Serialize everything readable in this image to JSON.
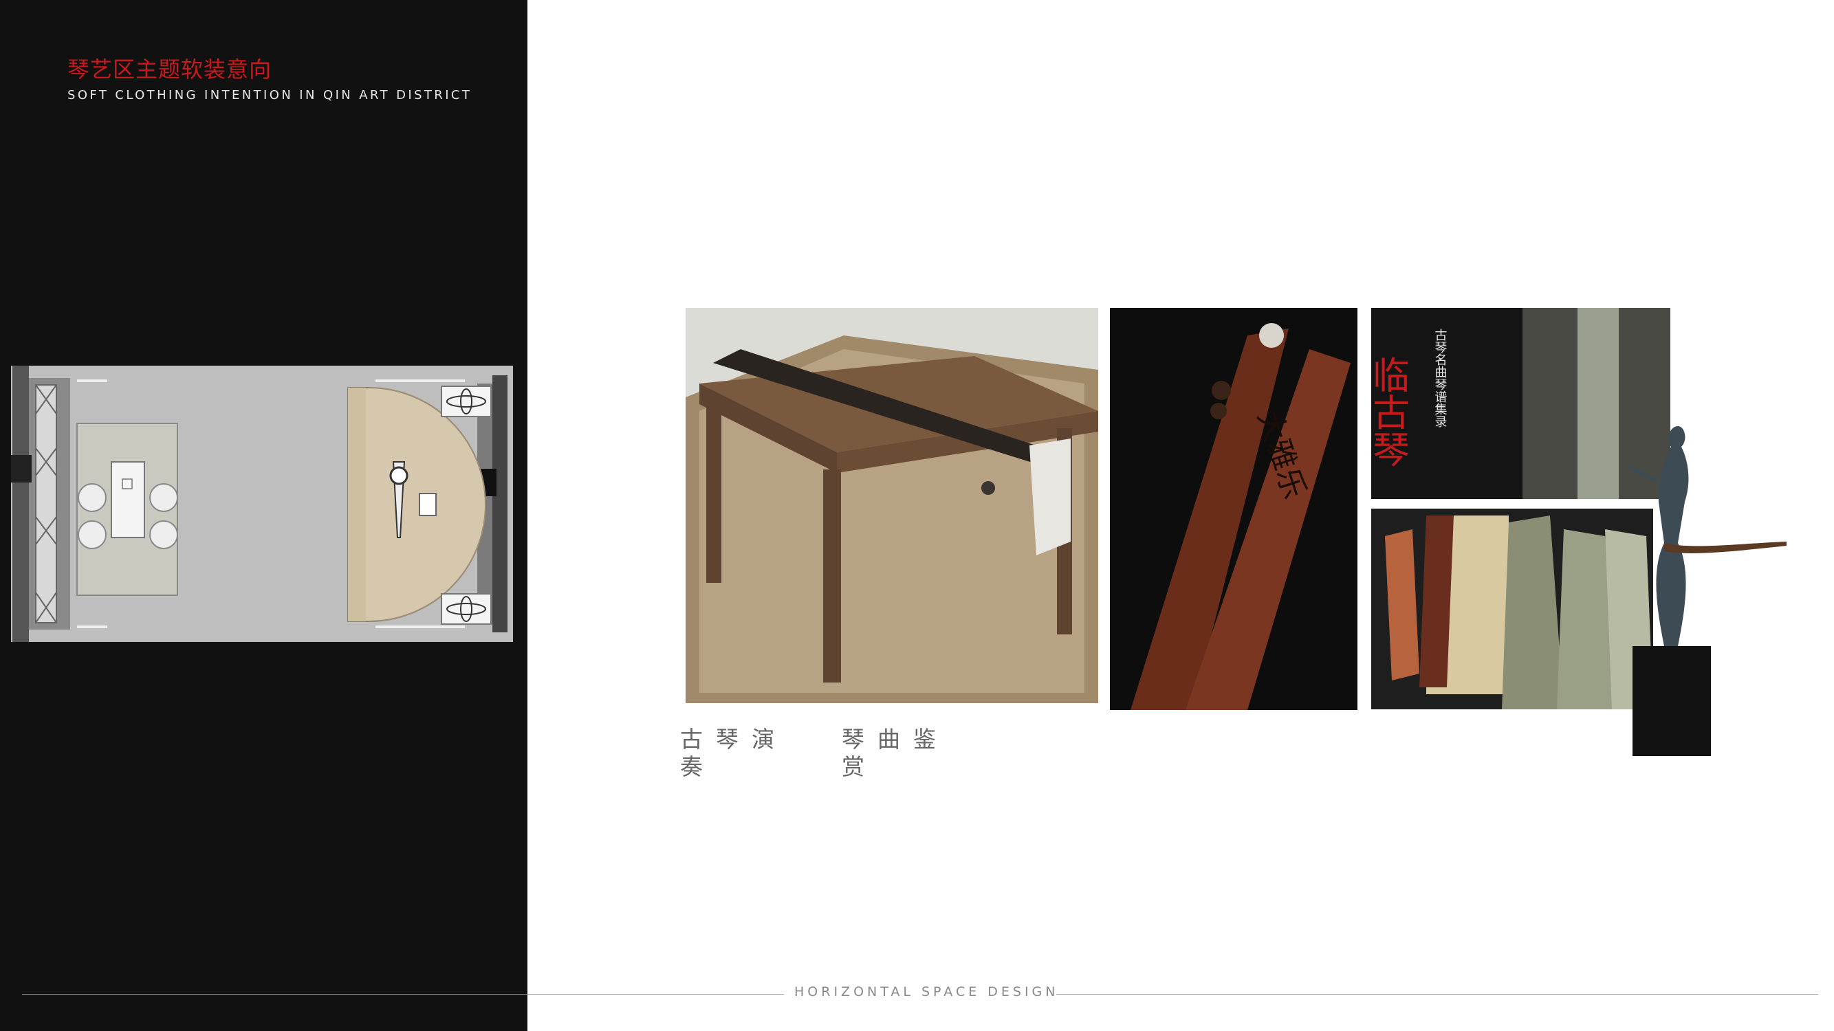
{
  "header": {
    "title_cn": "琴艺区主题软装意向",
    "title_en": "SOFT CLOTHING INTENTION IN QIN ART DISTRICT"
  },
  "footer": {
    "label": "HORIZONTAL SPACE DESIGN"
  },
  "captions": {
    "performance_line1": "古琴演",
    "performance_line2": "奏",
    "appreciation_line1": "琴曲鉴",
    "appreciation_line2": "赏"
  },
  "images": {
    "bookmark_text": "大雅乐",
    "book_title": "古琴名曲琴谱集录",
    "book_calligraphy": "临古琴"
  },
  "colors": {
    "panel": "#111111",
    "title_red": "#c8191e",
    "footer_gray": "#8a8a8a",
    "caption_gray": "#666666"
  }
}
